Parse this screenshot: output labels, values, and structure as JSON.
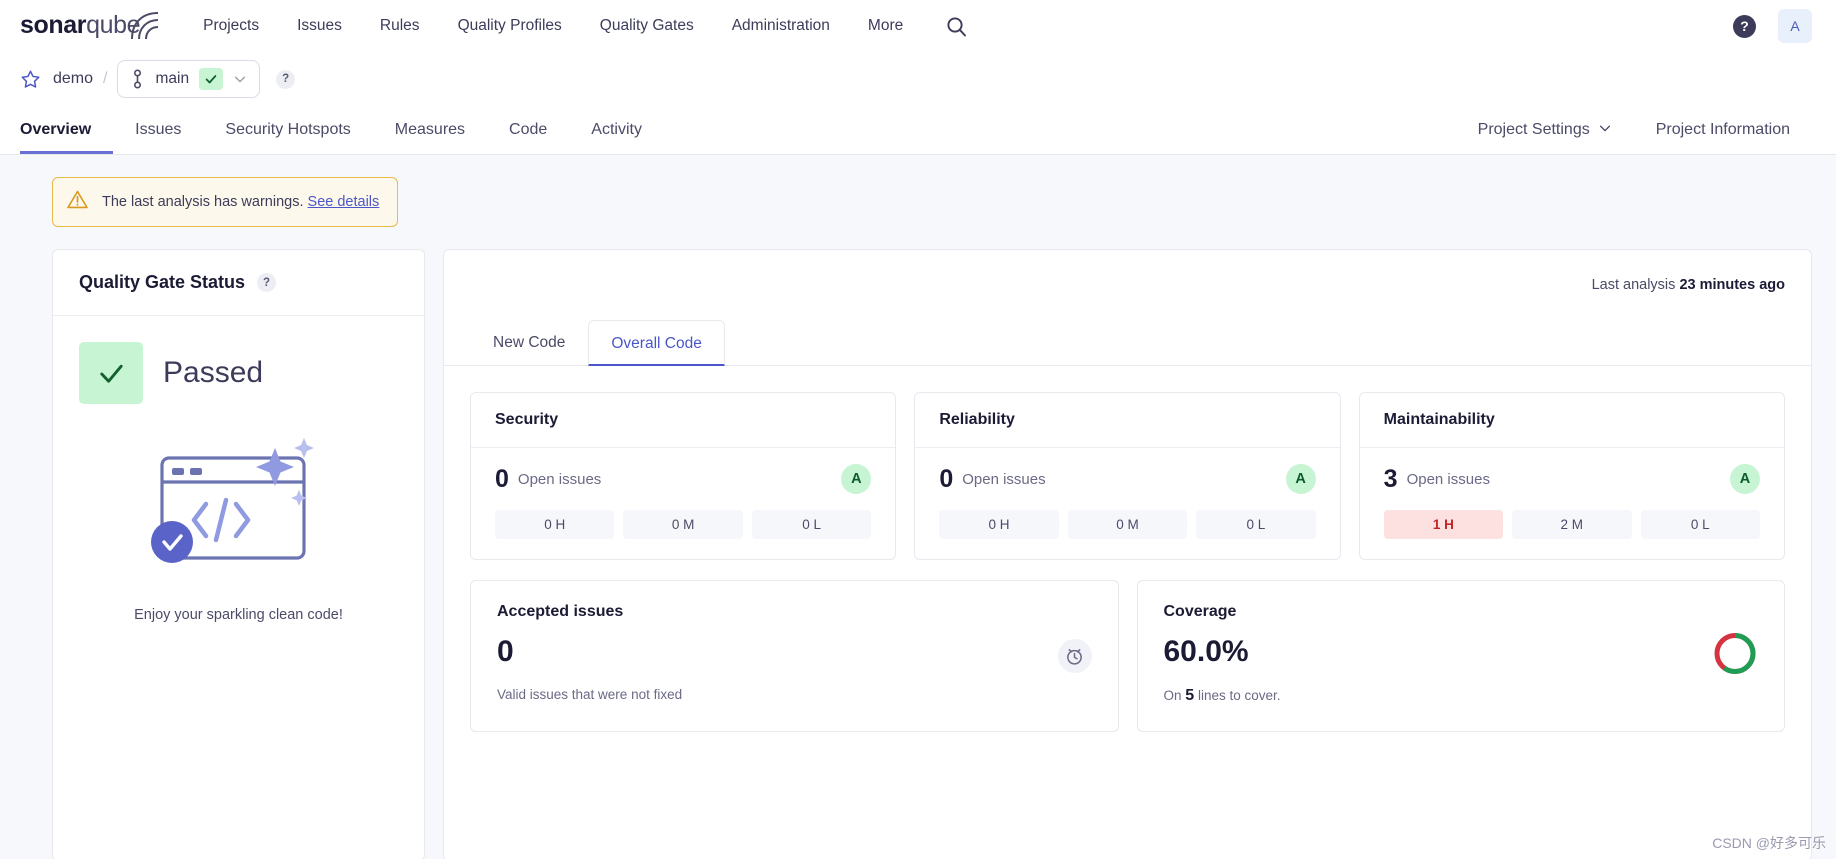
{
  "topnav": {
    "logo": {
      "bold": "sonar",
      "normal": "qube",
      "icon": "sonarqube-logo"
    },
    "menu": [
      {
        "label": "Projects"
      },
      {
        "label": "Issues"
      },
      {
        "label": "Rules"
      },
      {
        "label": "Quality Profiles"
      },
      {
        "label": "Quality Gates"
      },
      {
        "label": "Administration"
      },
      {
        "label": "More"
      }
    ],
    "search_icon": "search-icon",
    "help_icon": "help-icon",
    "help_label": "?",
    "avatar_label": "A"
  },
  "project_header": {
    "favorite_icon": "star-icon",
    "project_name": "demo",
    "separator": "/",
    "branch": {
      "icon": "branch-icon",
      "label": "main",
      "status_icon": "check-icon",
      "chevron_icon": "chevron-down-icon"
    },
    "help_label": "?",
    "tabs": [
      {
        "label": "Overview",
        "active": true
      },
      {
        "label": "Issues",
        "active": false
      },
      {
        "label": "Security Hotspots",
        "active": false
      },
      {
        "label": "Measures",
        "active": false
      },
      {
        "label": "Code",
        "active": false
      },
      {
        "label": "Activity",
        "active": false
      }
    ],
    "right_tabs": [
      {
        "label": "Project Settings",
        "has_chevron": true
      },
      {
        "label": "Project Information",
        "has_chevron": false
      }
    ]
  },
  "banner": {
    "warning_icon": "warning-icon",
    "text": "The last analysis has warnings.",
    "link": "See details"
  },
  "quality_gate": {
    "title": "Quality Gate Status",
    "help_label": "?",
    "status_icon": "check-icon",
    "status": "Passed",
    "illustration": "clean-code-illustration",
    "caption": "Enjoy your sparkling clean code!"
  },
  "main_panel": {
    "last_analysis_prefix": "Last analysis",
    "last_analysis_value": "23 minutes ago",
    "code_tabs": [
      {
        "label": "New Code",
        "active": false
      },
      {
        "label": "Overall Code",
        "active": true
      }
    ],
    "metrics": [
      {
        "title": "Security",
        "count": "0",
        "count_label": "Open issues",
        "rating": "A",
        "chips": [
          {
            "label": "0 H",
            "severity": "none"
          },
          {
            "label": "0 M",
            "severity": "none"
          },
          {
            "label": "0 L",
            "severity": "none"
          }
        ]
      },
      {
        "title": "Reliability",
        "count": "0",
        "count_label": "Open issues",
        "rating": "A",
        "chips": [
          {
            "label": "0 H",
            "severity": "none"
          },
          {
            "label": "0 M",
            "severity": "none"
          },
          {
            "label": "0 L",
            "severity": "none"
          }
        ]
      },
      {
        "title": "Maintainability",
        "count": "3",
        "count_label": "Open issues",
        "rating": "A",
        "chips": [
          {
            "label": "1 H",
            "severity": "high"
          },
          {
            "label": "2 M",
            "severity": "none"
          },
          {
            "label": "0 L",
            "severity": "none"
          }
        ]
      }
    ],
    "accepted_issues": {
      "title": "Accepted issues",
      "value": "0",
      "subtitle": "Valid issues that were not fixed",
      "icon": "clock-icon"
    },
    "coverage": {
      "title": "Coverage",
      "value": "60.0%",
      "sub_prefix": "On",
      "sub_value": "5",
      "sub_suffix": "lines to cover.",
      "donut_covered_pct": 60,
      "donut_covered_color": "#1f9d55",
      "donut_uncovered_color": "#d4333f"
    }
  },
  "watermark": "CSDN @好多可乐",
  "colors": {
    "accent": "#4b57c8",
    "active_tab_underline": "#6a6fd4",
    "pass_green_bg": "#c7f4d3",
    "pass_green_fg": "#0b5b2c",
    "warn_border": "#e8bb4a",
    "warn_bg": "#fdf8ec",
    "high_chip_bg": "#fde0e0",
    "high_chip_fg": "#c02626",
    "page_bg": "#f7f8fb"
  }
}
